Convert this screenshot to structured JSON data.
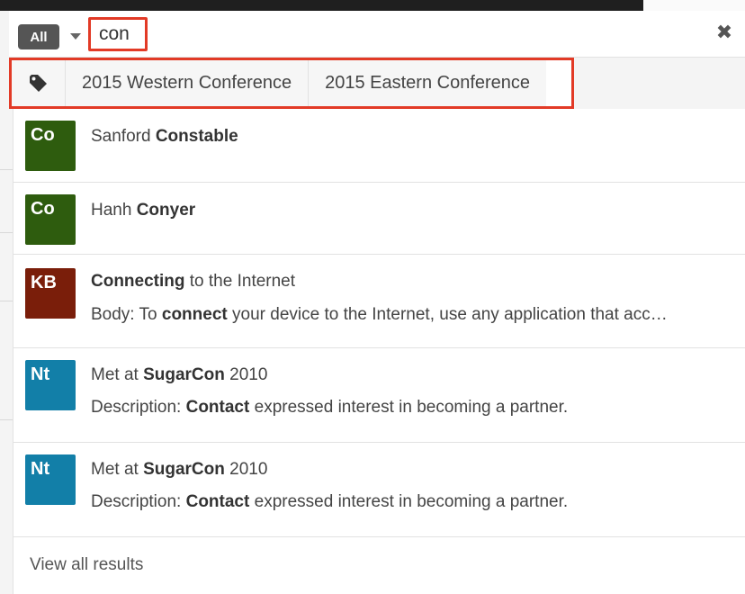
{
  "search": {
    "module_label": "All",
    "query": "con"
  },
  "tags": [
    {
      "label": "2015 Western Conference"
    },
    {
      "label": "2015 Eastern Conference"
    }
  ],
  "results": [
    {
      "badge": "Co",
      "badge_color": "#2e5c0e",
      "line1": {
        "pre": "Sanford ",
        "bold": "Constable",
        "post": ""
      }
    },
    {
      "badge": "Co",
      "badge_color": "#2e5c0e",
      "line1": {
        "pre": "Hanh ",
        "bold": "Conyer",
        "post": ""
      }
    },
    {
      "badge": "KB",
      "badge_color": "#7a1e0a",
      "line1": {
        "pre": "",
        "bold": "Connecting",
        "post": " to the Internet"
      },
      "line2": {
        "pre": "Body: To ",
        "bold": "connect",
        "post": " your device to the Internet, use any application that acc…"
      }
    },
    {
      "badge": "Nt",
      "badge_color": "#127fa8",
      "line1": {
        "pre": "Met at ",
        "bold": "SugarCon",
        "post": " 2010"
      },
      "line2": {
        "pre": "Description: ",
        "bold": "Contact",
        "post": " expressed interest in becoming a partner."
      }
    },
    {
      "badge": "Nt",
      "badge_color": "#127fa8",
      "line1": {
        "pre": "Met at ",
        "bold": "SugarCon",
        "post": " 2010"
      },
      "line2": {
        "pre": "Description: ",
        "bold": "Contact",
        "post": " expressed interest in becoming a partner."
      }
    }
  ],
  "view_all_label": "View all results",
  "colors": {
    "highlight_border": "#e23a26",
    "contact_badge": "#2e5c0e",
    "kb_badge": "#7a1e0a",
    "note_badge": "#127fa8"
  },
  "icons": {
    "tag": "tag-icon",
    "dropdown": "chevron-down-icon",
    "clear": "close-icon"
  }
}
